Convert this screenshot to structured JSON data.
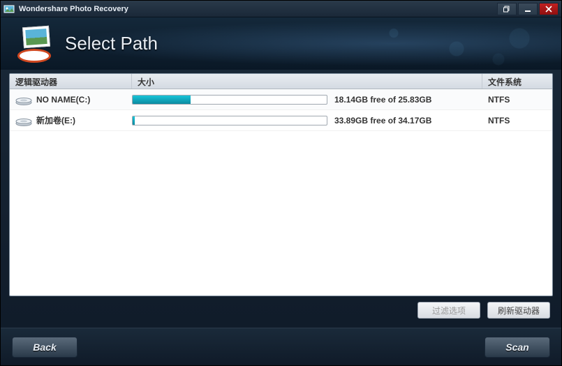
{
  "titlebar": {
    "title": "Wondershare Photo Recovery"
  },
  "header": {
    "title": "Select Path"
  },
  "columns": {
    "name": "逻辑驱动器",
    "size": "大小",
    "filesystem": "文件系统"
  },
  "drives": [
    {
      "name": "NO NAME(C:)",
      "free": "18.14GB free of 25.83GB",
      "fs": "NTFS",
      "used_pct": 30
    },
    {
      "name": "新加卷(E:)",
      "free": "33.89GB free of 34.17GB",
      "fs": "NTFS",
      "used_pct": 1
    }
  ],
  "buttons": {
    "filter": "过滤选项",
    "refresh": "刷新驱动器",
    "back": "Back",
    "scan": "Scan"
  }
}
